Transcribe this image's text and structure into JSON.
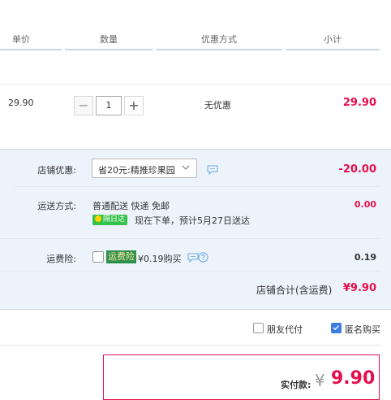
{
  "header": {
    "col_unit_price": "单价",
    "col_quantity": "数量",
    "col_discount": "优惠方式",
    "col_subtotal": "小计"
  },
  "item": {
    "unit_price": "29.90",
    "quantity": "1",
    "minus": "−",
    "plus": "+",
    "discount": "无优惠",
    "subtotal": "29.90"
  },
  "shop": {
    "promo_label": "店铺优惠:",
    "promo_value": "省20元:精推珍果园",
    "promo_amount": "-20.00",
    "shipping_label": "运送方式:",
    "shipping_value": "普通配送 快递 免邮",
    "shipping_badge": "隔日达",
    "shipping_note": "现在下单，预计5月27日送达",
    "shipping_amount": "0.00",
    "insurance_label": "运费险:",
    "insurance_tag": "运费险",
    "insurance_text": "¥0.19购买",
    "insurance_amount": "0.19",
    "total_label": "店铺合计(含运费)",
    "total_amount": "¥9.90"
  },
  "options": {
    "friend_pay": "朋友代付",
    "friend_pay_checked": false,
    "anonymous": "匿名购买",
    "anonymous_checked": true
  },
  "payment": {
    "label": "实付款:",
    "currency": "¥",
    "amount": "9.90"
  },
  "icons": {
    "chat": "chat-bubble-icon",
    "help": "question-circle-icon",
    "chevron": "chevron-down-icon",
    "lightning": "lightning-icon",
    "checkmark": "checkmark-icon"
  },
  "colors": {
    "price_red": "#e4104d",
    "panel_bg": "#edf3fb",
    "badge_green": "#34c24b",
    "check_blue": "#3b7de0"
  }
}
